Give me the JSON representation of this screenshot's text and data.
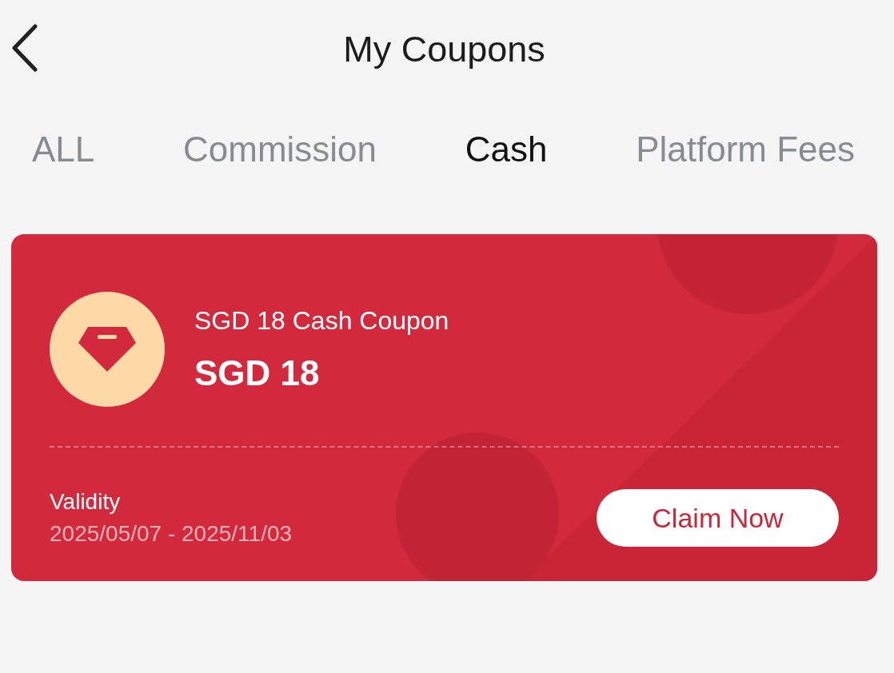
{
  "header": {
    "title": "My Coupons"
  },
  "tabs": [
    {
      "label": "ALL",
      "selected": false
    },
    {
      "label": "Commission",
      "selected": false
    },
    {
      "label": "Cash",
      "selected": true
    },
    {
      "label": "Platform Fees",
      "selected": false
    }
  ],
  "coupons": [
    {
      "name": "SGD 18 Cash Coupon",
      "amount": "SGD 18",
      "validity_label": "Validity",
      "validity": "2025/05/07 - 2025/11/03",
      "action": "Claim Now"
    }
  ]
}
